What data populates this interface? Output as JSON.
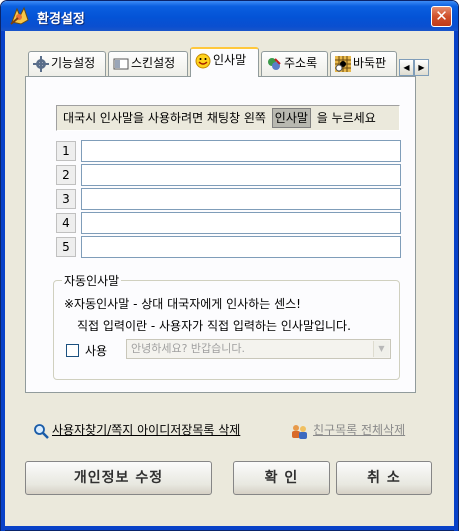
{
  "window": {
    "title": "환경설정",
    "title_icon": "app-spark-icon",
    "close_label": "✕",
    "colors": {
      "title_bar": "#0453d6",
      "face": "#ebe9dc",
      "panel": "#fcfcfe",
      "accent_tab": "#ffc83c"
    }
  },
  "tabs": [
    {
      "label": "기능설정",
      "icon": "gear-icon",
      "active": false
    },
    {
      "label": "스킨설정",
      "icon": "skin-icon",
      "active": false
    },
    {
      "label": "인사말",
      "icon": "smiley-icon",
      "active": true
    },
    {
      "label": "주소록",
      "icon": "address-book-icon",
      "active": false
    },
    {
      "label": "바둑판",
      "icon": "baduk-board-icon",
      "active": false
    }
  ],
  "tab_scroll": {
    "left": "◀",
    "right": "▶"
  },
  "greetings": {
    "tip_before": "대국시 인사말을 사용하려면 채팅창 왼쪽",
    "tip_chip": "인사말",
    "tip_after": "을 누르세요",
    "rows": [
      {
        "num": "1",
        "value": ""
      },
      {
        "num": "2",
        "value": ""
      },
      {
        "num": "3",
        "value": ""
      },
      {
        "num": "4",
        "value": ""
      },
      {
        "num": "5",
        "value": ""
      }
    ]
  },
  "auto": {
    "legend": "자동인사말",
    "line1": "※자동인사말 - 상대 대국자에게 인사하는 센스!",
    "line2": "직접 입력이란 - 사용자가 직접 입력하는 인사말입니다.",
    "use_label": "사용",
    "use_checked": false,
    "select_value": "안녕하세요? 반갑습니다.",
    "select_arrow": "▼"
  },
  "links": {
    "search_label": "사용자찾기/쪽지 아이디저장목록 삭제",
    "search_icon": "magnifier-icon",
    "friends_label": "친구목록 전체삭제",
    "friends_icon": "people-icon"
  },
  "buttons": {
    "profile_label": "개인정보 수정",
    "ok_label": "확 인",
    "cancel_label": "취 소"
  }
}
